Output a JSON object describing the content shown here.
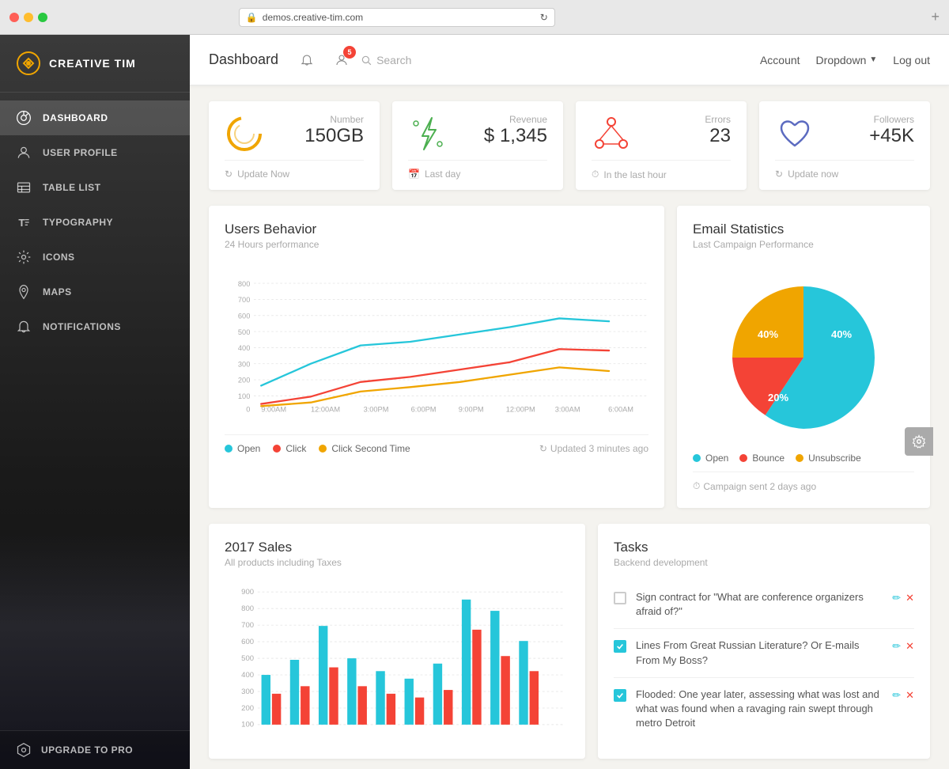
{
  "browser": {
    "url": "demos.creative-tim.com",
    "new_tab_label": "+"
  },
  "sidebar": {
    "logo": "CREATIVE TIM",
    "nav_items": [
      {
        "id": "dashboard",
        "label": "DASHBOARD",
        "active": true
      },
      {
        "id": "user-profile",
        "label": "USER PROFILE",
        "active": false
      },
      {
        "id": "table-list",
        "label": "TABLE LIST",
        "active": false
      },
      {
        "id": "typography",
        "label": "TYPOGRAPHY",
        "active": false
      },
      {
        "id": "icons",
        "label": "ICONS",
        "active": false
      },
      {
        "id": "maps",
        "label": "MAPS",
        "active": false
      },
      {
        "id": "notifications",
        "label": "NOTIFICATIONS",
        "active": false
      }
    ],
    "upgrade_label": "UPGRADE TO PRO"
  },
  "header": {
    "title": "Dashboard",
    "notification_count": "5",
    "search_placeholder": "Search",
    "account_label": "Account",
    "dropdown_label": "Dropdown",
    "logout_label": "Log out"
  },
  "stats": [
    {
      "label": "Number",
      "value": "150GB",
      "footer": "Update Now",
      "color": "#f0a500",
      "icon": "donut"
    },
    {
      "label": "Revenue",
      "value": "$ 1,345",
      "footer": "Last day",
      "color": "#4caf50",
      "icon": "flash"
    },
    {
      "label": "Errors",
      "value": "23",
      "footer": "In the last hour",
      "color": "#f44336",
      "icon": "nodes"
    },
    {
      "label": "Followers",
      "value": "+45K",
      "footer": "Update now",
      "color": "#5c6bc0",
      "icon": "heart"
    }
  ],
  "users_behavior": {
    "title": "Users Behavior",
    "subtitle": "24 Hours performance",
    "update_text": "Updated 3 minutes ago",
    "x_labels": [
      "9:00AM",
      "12:00AM",
      "3:00PM",
      "6:00PM",
      "9:00PM",
      "12:00PM",
      "3:00AM",
      "6:00AM"
    ],
    "y_labels": [
      "800",
      "700",
      "600",
      "500",
      "400",
      "300",
      "200",
      "100",
      "0"
    ],
    "legend": [
      {
        "label": "Open",
        "color": "#26c6da"
      },
      {
        "label": "Click",
        "color": "#f44336"
      },
      {
        "label": "Click Second Time",
        "color": "#f0a500"
      }
    ]
  },
  "email_stats": {
    "title": "Email Statistics",
    "subtitle": "Last Campaign Performance",
    "segments": [
      {
        "label": "Open",
        "percent": "40%",
        "color": "#26c6da"
      },
      {
        "label": "Bounce",
        "percent": "20%",
        "color": "#f44336"
      },
      {
        "label": "Unsubscribe",
        "percent": "40%",
        "color": "#f0a500"
      }
    ],
    "footer_text": "Campaign sent 2 days ago"
  },
  "sales_2017": {
    "title": "2017 Sales",
    "subtitle": "All products including Taxes"
  },
  "tasks": {
    "title": "Tasks",
    "subtitle": "Backend development",
    "items": [
      {
        "text": "Sign contract for \"What are conference organizers afraid of?\"",
        "checked": false
      },
      {
        "text": "Lines From Great Russian Literature? Or E-mails From My Boss?",
        "checked": true
      },
      {
        "text": "Flooded: One year later, assessing what was lost and what was found when a ravaging rain swept through metro Detroit",
        "checked": true
      }
    ]
  }
}
